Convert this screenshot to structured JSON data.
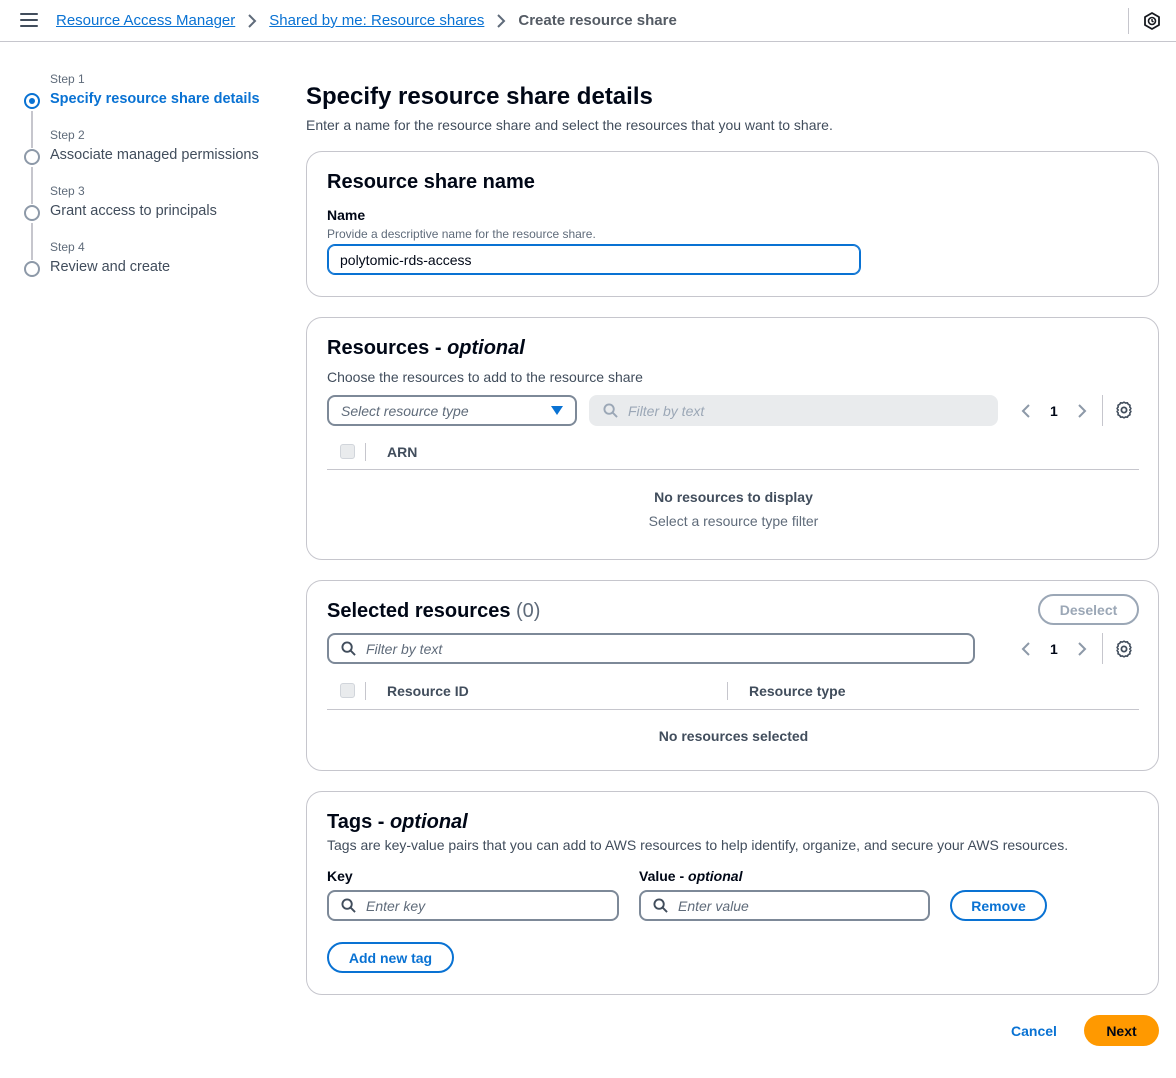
{
  "breadcrumb": {
    "items": [
      "Resource Access Manager",
      "Shared by me: Resource shares"
    ],
    "current": "Create resource share"
  },
  "icons": {
    "menu": "hamburger-icon",
    "top_right": "notifications-icon",
    "breadcrumb_separator": "chevron-right-icon",
    "search": "search-icon",
    "settings": "gear-icon"
  },
  "colors": {
    "accent": "#0972d3",
    "primary_button": "#ff9900",
    "border": "#c6c6cd"
  },
  "steps": [
    {
      "number": "Step 1",
      "label": "Specify resource share details",
      "active": true
    },
    {
      "number": "Step 2",
      "label": "Associate managed permissions",
      "active": false
    },
    {
      "number": "Step 3",
      "label": "Grant access to principals",
      "active": false
    },
    {
      "number": "Step 4",
      "label": "Review and create",
      "active": false
    }
  ],
  "page": {
    "title": "Specify resource share details",
    "description": "Enter a name for the resource share and select the resources that you want to share."
  },
  "share_name": {
    "title": "Resource share name",
    "field_label": "Name",
    "field_hint": "Provide a descriptive name for the resource share.",
    "value": "polytomic-rds-access"
  },
  "resources": {
    "title": "Resources - ",
    "title_optional": "optional",
    "description": "Choose the resources to add to the resource share",
    "select_placeholder": "Select resource type",
    "filter_placeholder": "Filter by text",
    "page": "1",
    "column": "ARN",
    "empty_title": "No resources to display",
    "empty_subtitle": "Select a resource type filter"
  },
  "selected": {
    "title": "Selected resources",
    "count": "(0)",
    "deselect_label": "Deselect",
    "filter_placeholder": "Filter by text",
    "page": "1",
    "columns": [
      "Resource ID",
      "Resource type"
    ],
    "empty": "No resources selected"
  },
  "tags": {
    "title": "Tags - ",
    "title_optional": "optional",
    "description": "Tags are key-value pairs that you can add to AWS resources to help identify, organize, and secure your AWS resources.",
    "key_label": "Key",
    "value_label": "Value - ",
    "value_optional": "optional",
    "key_placeholder": "Enter key",
    "value_placeholder": "Enter value",
    "remove_label": "Remove",
    "add_label": "Add new tag"
  },
  "footer": {
    "cancel_label": "Cancel",
    "next_label": "Next"
  }
}
